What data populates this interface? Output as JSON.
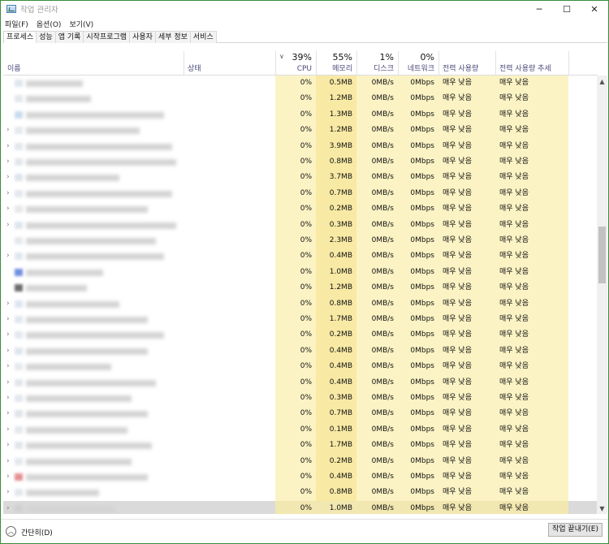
{
  "window": {
    "title": "작업 관리자",
    "controls": [
      "─",
      "☐",
      "✕"
    ]
  },
  "menu": [
    "파일(F)",
    "옵션(O)",
    "보기(V)"
  ],
  "tabs": [
    "프로세스",
    "성능",
    "앱 기록",
    "시작프로그램",
    "사용자",
    "세부 정보",
    "서비스"
  ],
  "active_tab": "프로세스",
  "columns": {
    "name": "이름",
    "status": "상태",
    "cpu": {
      "pct": "39%",
      "label": "CPU"
    },
    "memory": {
      "pct": "55%",
      "label": "메모리"
    },
    "disk": {
      "pct": "1%",
      "label": "디스크"
    },
    "network": {
      "pct": "0%",
      "label": "네트워크"
    },
    "power": "전력 사용량",
    "power_trend": "전력 사용량 추세"
  },
  "rows": [
    {
      "expand": false,
      "cpu": "0%",
      "mem": "0.5MB",
      "disk": "0MB/s",
      "net": "0Mbps",
      "power": "매우 낮음",
      "trend": "매우 낮음"
    },
    {
      "expand": false,
      "cpu": "0%",
      "mem": "1.2MB",
      "disk": "0MB/s",
      "net": "0Mbps",
      "power": "매우 낮음",
      "trend": "매우 낮음"
    },
    {
      "expand": false,
      "cpu": "0%",
      "mem": "1.3MB",
      "disk": "0MB/s",
      "net": "0Mbps",
      "power": "매우 낮음",
      "trend": "매우 낮음"
    },
    {
      "expand": true,
      "cpu": "0%",
      "mem": "1.2MB",
      "disk": "0MB/s",
      "net": "0Mbps",
      "power": "매우 낮음",
      "trend": "매우 낮음"
    },
    {
      "expand": true,
      "cpu": "0%",
      "mem": "3.9MB",
      "disk": "0MB/s",
      "net": "0Mbps",
      "power": "매우 낮음",
      "trend": "매우 낮음"
    },
    {
      "expand": true,
      "cpu": "0%",
      "mem": "0.8MB",
      "disk": "0MB/s",
      "net": "0Mbps",
      "power": "매우 낮음",
      "trend": "매우 낮음"
    },
    {
      "expand": true,
      "cpu": "0%",
      "mem": "3.7MB",
      "disk": "0MB/s",
      "net": "0Mbps",
      "power": "매우 낮음",
      "trend": "매우 낮음"
    },
    {
      "expand": true,
      "cpu": "0%",
      "mem": "0.7MB",
      "disk": "0MB/s",
      "net": "0Mbps",
      "power": "매우 낮음",
      "trend": "매우 낮음"
    },
    {
      "expand": true,
      "cpu": "0%",
      "mem": "0.2MB",
      "disk": "0MB/s",
      "net": "0Mbps",
      "power": "매우 낮음",
      "trend": "매우 낮음"
    },
    {
      "expand": true,
      "cpu": "0%",
      "mem": "0.3MB",
      "disk": "0MB/s",
      "net": "0Mbps",
      "power": "매우 낮음",
      "trend": "매우 낮음"
    },
    {
      "expand": false,
      "cpu": "0%",
      "mem": "2.3MB",
      "disk": "0MB/s",
      "net": "0Mbps",
      "power": "매우 낮음",
      "trend": "매우 낮음"
    },
    {
      "expand": true,
      "cpu": "0%",
      "mem": "0.4MB",
      "disk": "0MB/s",
      "net": "0Mbps",
      "power": "매우 낮음",
      "trend": "매우 낮음"
    },
    {
      "expand": false,
      "cpu": "0%",
      "mem": "1.0MB",
      "disk": "0MB/s",
      "net": "0Mbps",
      "power": "매우 낮음",
      "trend": "매우 낮음"
    },
    {
      "expand": false,
      "cpu": "0%",
      "mem": "1.2MB",
      "disk": "0MB/s",
      "net": "0Mbps",
      "power": "매우 낮음",
      "trend": "매우 낮음"
    },
    {
      "expand": true,
      "cpu": "0%",
      "mem": "0.8MB",
      "disk": "0MB/s",
      "net": "0Mbps",
      "power": "매우 낮음",
      "trend": "매우 낮음"
    },
    {
      "expand": true,
      "cpu": "0%",
      "mem": "1.7MB",
      "disk": "0MB/s",
      "net": "0Mbps",
      "power": "매우 낮음",
      "trend": "매우 낮음"
    },
    {
      "expand": true,
      "cpu": "0%",
      "mem": "0.2MB",
      "disk": "0MB/s",
      "net": "0Mbps",
      "power": "매우 낮음",
      "trend": "매우 낮음"
    },
    {
      "expand": true,
      "cpu": "0%",
      "mem": "0.4MB",
      "disk": "0MB/s",
      "net": "0Mbps",
      "power": "매우 낮음",
      "trend": "매우 낮음"
    },
    {
      "expand": true,
      "cpu": "0%",
      "mem": "0.4MB",
      "disk": "0MB/s",
      "net": "0Mbps",
      "power": "매우 낮음",
      "trend": "매우 낮음"
    },
    {
      "expand": true,
      "cpu": "0%",
      "mem": "0.4MB",
      "disk": "0MB/s",
      "net": "0Mbps",
      "power": "매우 낮음",
      "trend": "매우 낮음"
    },
    {
      "expand": true,
      "cpu": "0%",
      "mem": "0.3MB",
      "disk": "0MB/s",
      "net": "0Mbps",
      "power": "매우 낮음",
      "trend": "매우 낮음"
    },
    {
      "expand": true,
      "cpu": "0%",
      "mem": "0.7MB",
      "disk": "0MB/s",
      "net": "0Mbps",
      "power": "매우 낮음",
      "trend": "매우 낮음"
    },
    {
      "expand": true,
      "cpu": "0%",
      "mem": "0.1MB",
      "disk": "0MB/s",
      "net": "0Mbps",
      "power": "매우 낮음",
      "trend": "매우 낮음"
    },
    {
      "expand": true,
      "cpu": "0%",
      "mem": "1.7MB",
      "disk": "0MB/s",
      "net": "0Mbps",
      "power": "매우 낮음",
      "trend": "매우 낮음"
    },
    {
      "expand": true,
      "cpu": "0%",
      "mem": "0.2MB",
      "disk": "0MB/s",
      "net": "0Mbps",
      "power": "매우 낮음",
      "trend": "매우 낮음"
    },
    {
      "expand": true,
      "cpu": "0%",
      "mem": "0.4MB",
      "disk": "0MB/s",
      "net": "0Mbps",
      "power": "매우 낮음",
      "trend": "매우 낮음"
    },
    {
      "expand": true,
      "cpu": "0%",
      "mem": "0.8MB",
      "disk": "0MB/s",
      "net": "0Mbps",
      "power": "매우 낮음",
      "trend": "매우 낮음"
    },
    {
      "expand": true,
      "cpu": "0%",
      "mem": "1.0MB",
      "disk": "0MB/s",
      "net": "0Mbps",
      "power": "매우 낮음",
      "trend": "매우 낮음"
    }
  ],
  "selected_row": 27,
  "footer": {
    "fewer_details": "간단히(D)",
    "end_task": "작업 끝내기(E)"
  }
}
